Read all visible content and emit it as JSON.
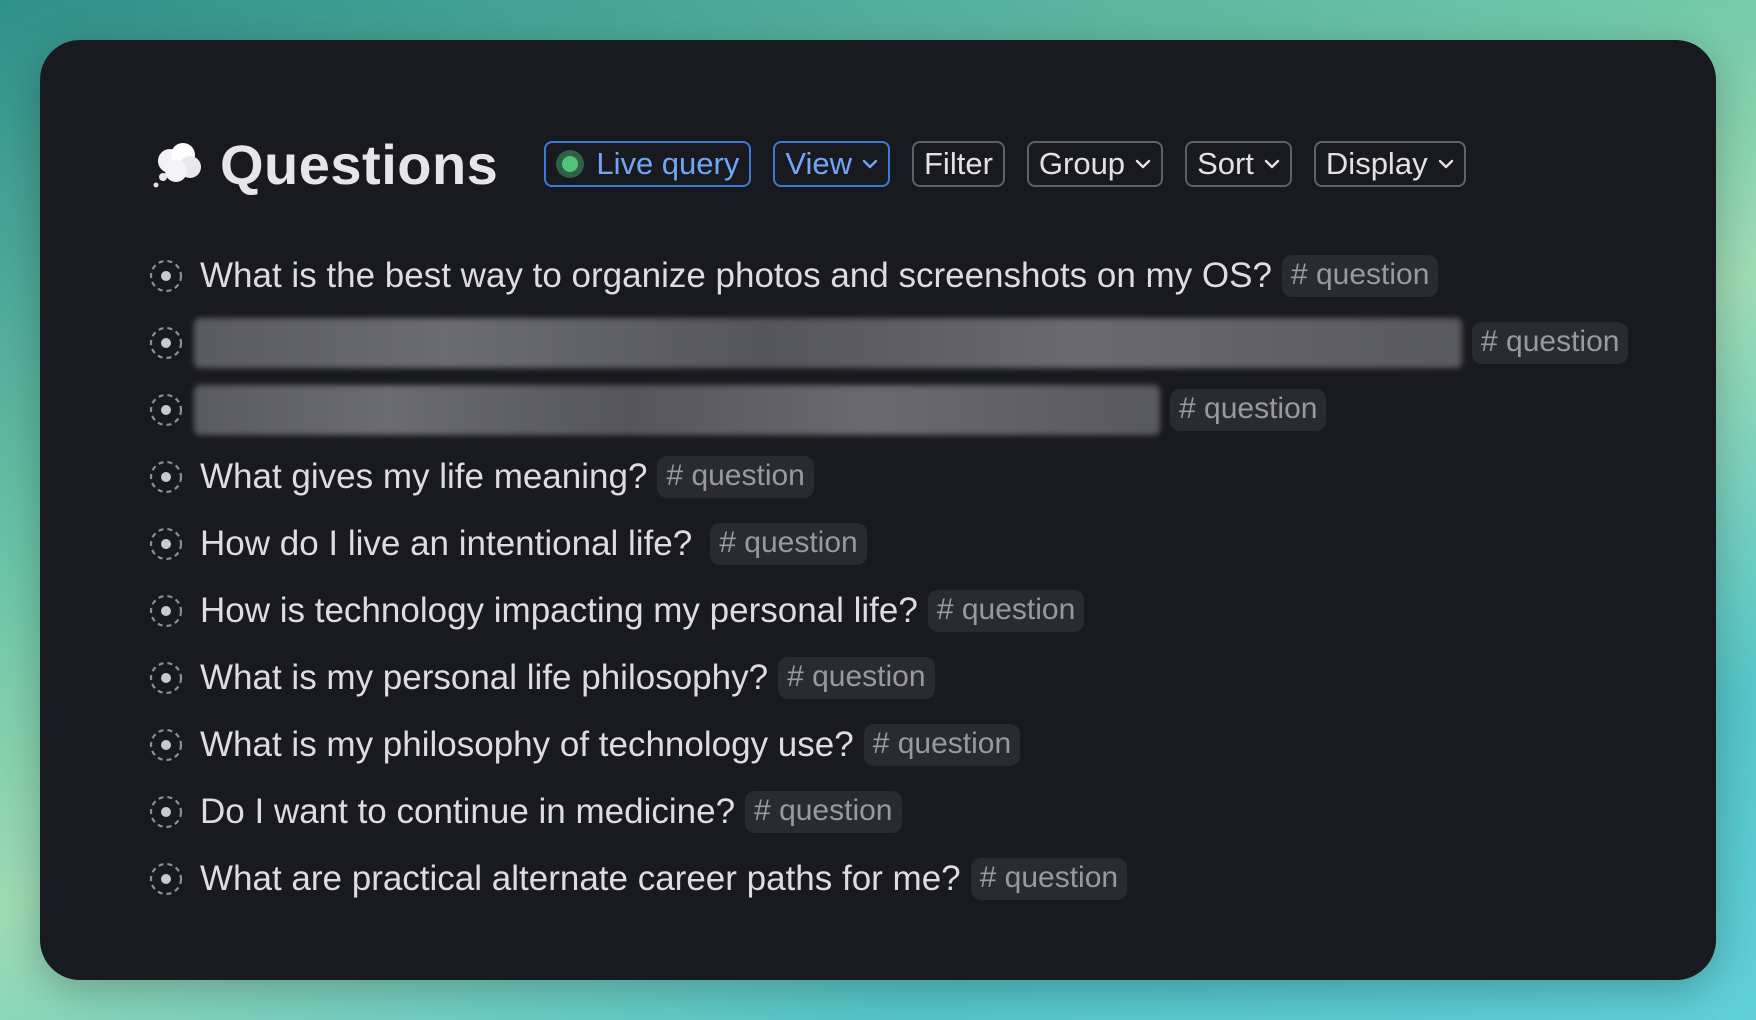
{
  "page": {
    "title": "Questions",
    "icon": "thought-bubble-icon"
  },
  "toolbar": {
    "live_query": "Live query",
    "view": "View",
    "filter": "Filter",
    "group": "Group",
    "sort": "Sort",
    "display": "Display"
  },
  "items": [
    {
      "text": "What is the best way to organize photos and screenshots on my OS?",
      "tag": "# question",
      "blurred": false
    },
    {
      "text": "",
      "tag": "# question",
      "blurred": true
    },
    {
      "text": "",
      "tag": "# question",
      "blurred": true
    },
    {
      "text": "What gives my life meaning?",
      "tag": "# question",
      "blurred": false
    },
    {
      "text": "How do I live an intentional life?",
      "tag": "# question",
      "blurred": false
    },
    {
      "text": "How is technology impacting my personal life?",
      "tag": "# question",
      "blurred": false
    },
    {
      "text": "What is my personal life philosophy?",
      "tag": "# question",
      "blurred": false
    },
    {
      "text": "What is my philosophy of technology use?",
      "tag": "# question",
      "blurred": false
    },
    {
      "text": "Do I want to continue in medicine?",
      "tag": "# question",
      "blurred": false
    },
    {
      "text": "What are practical alternate career paths for me?",
      "tag": "# question",
      "blurred": false
    }
  ]
}
